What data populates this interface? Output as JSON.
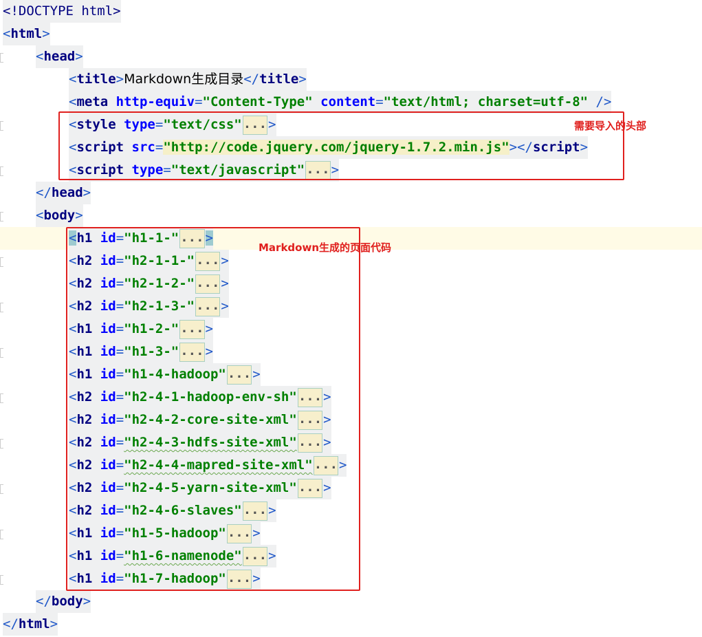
{
  "editor": {
    "lines": {
      "doctype": "<!DOCTYPE html>",
      "html_open_tag": "html",
      "head_open_tag": "head",
      "title_tag": "title",
      "title_text": "Markdown生成目录",
      "meta_tag": "meta",
      "meta_attr1": "http-equiv",
      "meta_val1": "\"Content-Type\"",
      "meta_attr2": "content",
      "meta_val2": "\"text/html; charset=utf-8\"",
      "style_tag": "style",
      "style_attr": "type",
      "style_val": "\"text/css\"",
      "script1_tag": "script",
      "script1_attr": "src",
      "script1_val": "\"http://code.jquery.com/jquery-1.7.2.min.js\"",
      "script2_tag": "script",
      "script2_attr": "type",
      "script2_val": "\"text/javascript\"",
      "head_close_tag": "head",
      "body_open_tag": "body",
      "body_close_tag": "body",
      "html_close_tag": "html"
    },
    "fold_placeholder": "...",
    "headings": [
      {
        "tag": "h1",
        "attr": "id",
        "value": "\"h1-1-\""
      },
      {
        "tag": "h2",
        "attr": "id",
        "value": "\"h2-1-1-\""
      },
      {
        "tag": "h2",
        "attr": "id",
        "value": "\"h2-1-2-\""
      },
      {
        "tag": "h2",
        "attr": "id",
        "value": "\"h2-1-3-\""
      },
      {
        "tag": "h1",
        "attr": "id",
        "value": "\"h1-2-\""
      },
      {
        "tag": "h1",
        "attr": "id",
        "value": "\"h1-3-\""
      },
      {
        "tag": "h1",
        "attr": "id",
        "value": "\"h1-4-hadoop\""
      },
      {
        "tag": "h2",
        "attr": "id",
        "value": "\"h2-4-1-hadoop-env-sh\""
      },
      {
        "tag": "h2",
        "attr": "id",
        "value": "\"h2-4-2-core-site-xml\""
      },
      {
        "tag": "h2",
        "attr": "id",
        "value": "\"h2-4-3-hdfs-site-xml\""
      },
      {
        "tag": "h2",
        "attr": "id",
        "value": "\"h2-4-4-mapred-site-xml\""
      },
      {
        "tag": "h2",
        "attr": "id",
        "value": "\"h2-4-5-yarn-site-xml\""
      },
      {
        "tag": "h2",
        "attr": "id",
        "value": "\"h2-4-6-slaves\""
      },
      {
        "tag": "h1",
        "attr": "id",
        "value": "\"h1-5-hadoop\""
      },
      {
        "tag": "h1",
        "attr": "id",
        "value": "\"h1-6-namenode\""
      },
      {
        "tag": "h1",
        "attr": "id",
        "value": "\"h1-7-hadoop\""
      }
    ]
  },
  "annotations": {
    "head_imports_label": "需要导入的头部",
    "markdown_code_label": "Markdown生成的页面代码"
  },
  "colors": {
    "tag": "#000080",
    "attribute": "#0000ff",
    "string_value": "#008000",
    "annotation_red": "#e0201e",
    "fold_background": "#f7efcc",
    "current_line": "#fffbe6"
  }
}
